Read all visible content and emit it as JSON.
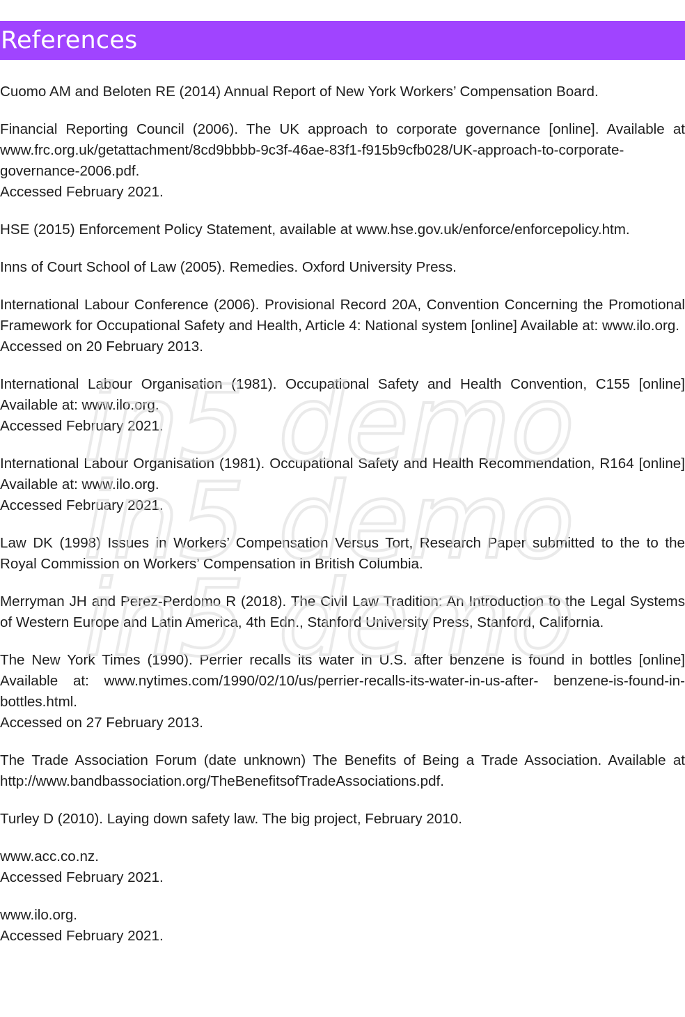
{
  "header": {
    "title": "References"
  },
  "references": [
    {
      "text": "Cuomo AM and Beloten RE (2014) Annual Report of New York Workers’ Compensation Board.",
      "accessed": ""
    },
    {
      "text": "Financial Reporting Council (2006). The UK approach to corporate governance [online]. Available at www.frc.org.uk/getattachment/8cd9bbbb-9c3f-46ae-83f1-f915b9cfb028/UK-approach-to-corporate-governance-2006.pdf.",
      "accessed": "Accessed February 2021."
    },
    {
      "text": "HSE (2015) Enforcement Policy Statement, available at www.hse.gov.uk/enforce/enforcepolicy.htm.",
      "accessed": ""
    },
    {
      "text": "Inns of Court School of Law (2005). Remedies. Oxford University Press.",
      "accessed": ""
    },
    {
      "text": "International Labour Conference (2006). Provisional Record 20A, Convention Concerning the Promotional Framework for Occupational Safety and Health, Article 4: National system [online] Available at: www.ilo.org.",
      "accessed": "Accessed on 20 February 2013."
    },
    {
      "text": "International Labour Organisation (1981). Occupational Safety and Health Convention, C155 [online] Available at: www.ilo.org.",
      "accessed": "Accessed February 2021."
    },
    {
      "text": "International Labour Organisation (1981). Occupational Safety and Health Recommendation, R164 [online] Available at: www.ilo.org.",
      "accessed": "Accessed February 2021."
    },
    {
      "text": "Law DK (1998) Issues in Workers’ Compensation Versus Tort, Research Paper submitted to the to the Royal Commission on Workers’ Compensation in British Columbia.",
      "accessed": ""
    },
    {
      "text": "Merryman JH and Perez-Perdomo R (2018). The Civil Law Tradition: An Introduction to the Legal Systems of Western Europe and Latin America, 4th Edn., Stanford University Press, Stanford, California.",
      "accessed": ""
    },
    {
      "text": "The New York Times (1990). Perrier recalls its water in U.S. after benzene is found in bottles [online] Available at: www.nytimes.com/1990/02/10/us/perrier-recalls-its-water-in-us-after- benzene-is-found-in-bottles.html.",
      "accessed": "Accessed on 27 February 2013."
    },
    {
      "text": "The Trade Association Forum (date unknown) The Benefits of Being a Trade Association. Available at http://www.bandbassociation.org/TheBenefitsofTradeAssociations.pdf.",
      "accessed": ""
    },
    {
      "text": "Turley D (2010). Laying down safety law. The big project, February 2010.",
      "accessed": ""
    },
    {
      "text": "www.acc.co.nz.",
      "accessed": "Accessed February 2021."
    },
    {
      "text": "www.ilo.org.",
      "accessed": "Accessed February 2021."
    }
  ],
  "watermark": {
    "text": "in5 demo",
    "color": "#d9d9d9"
  },
  "colors": {
    "header_bg": "#a044ff",
    "header_text": "#ffffff",
    "body_text": "#1e1e1e"
  }
}
